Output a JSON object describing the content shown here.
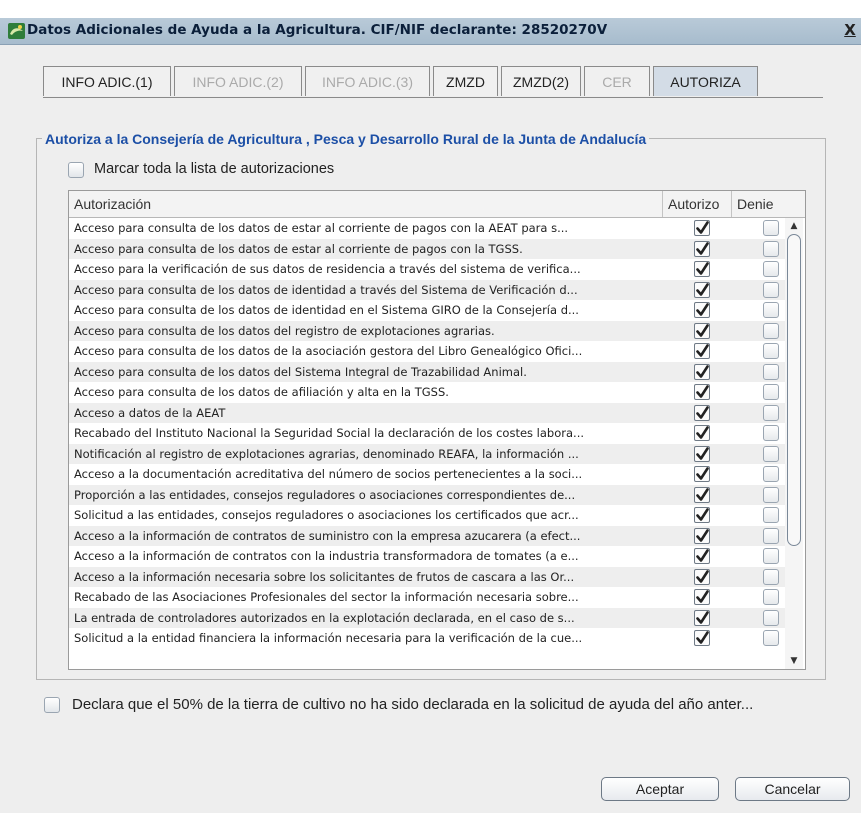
{
  "window": {
    "title": "Datos Adicionales de Ayuda a la Agricultura. CIF/NIF declarante: 28520270V",
    "close_label": "X"
  },
  "tabs": [
    {
      "label": "INFO ADIC.(1)",
      "state": "enabled"
    },
    {
      "label": "INFO ADIC.(2)",
      "state": "disabled"
    },
    {
      "label": "INFO ADIC.(3)",
      "state": "disabled"
    },
    {
      "label": "ZMZD",
      "state": "enabled"
    },
    {
      "label": "ZMZD(2)",
      "state": "enabled"
    },
    {
      "label": "CER",
      "state": "disabled"
    },
    {
      "label": "AUTORIZA",
      "state": "selected"
    }
  ],
  "group": {
    "title": "Autoriza a la Consejería de Agricultura , Pesca y Desarrollo Rural de la Junta de Andalucía",
    "mark_all_label": "Marcar toda la lista de autorizaciones"
  },
  "table": {
    "headers": [
      "Autorización",
      "Autorizo",
      "Denie"
    ],
    "rows": [
      {
        "text": "Acceso para consulta de los datos de estar al corriente de pagos con la AEAT  para s...",
        "autorizo": true,
        "deniego": false
      },
      {
        "text": "Acceso para consulta de los datos de estar al corriente de pagos con la TGSS.",
        "autorizo": true,
        "deniego": false
      },
      {
        "text": "Acceso para la verificación de sus datos de residencia a través del sistema de verifica...",
        "autorizo": true,
        "deniego": false
      },
      {
        "text": "Acceso para consulta de los datos de identidad a través del Sistema de Verificación d...",
        "autorizo": true,
        "deniego": false
      },
      {
        "text": "Acceso para consulta de los datos de identidad en el Sistema GIRO de la Consejería d...",
        "autorizo": true,
        "deniego": false
      },
      {
        "text": "Acceso para consulta de los datos del registro de explotaciones agrarias.",
        "autorizo": true,
        "deniego": false
      },
      {
        "text": "Acceso para consulta de los datos de la asociación gestora del Libro Genealógico Ofici...",
        "autorizo": true,
        "deniego": false
      },
      {
        "text": "Acceso para consulta de los datos del Sistema Integral de Trazabilidad Animal.",
        "autorizo": true,
        "deniego": false
      },
      {
        "text": "Acceso para consulta de los datos de afiliación y alta en la TGSS.",
        "autorizo": true,
        "deniego": false
      },
      {
        "text": "Acceso a datos de la AEAT",
        "autorizo": true,
        "deniego": false
      },
      {
        "text": "Recabado del Instituto Nacional la Seguridad Social la declaración de los costes labora...",
        "autorizo": true,
        "deniego": false
      },
      {
        "text": "Notificación al registro de explotaciones agrarias, denominado REAFA, la información ...",
        "autorizo": true,
        "deniego": false
      },
      {
        "text": "Acceso a la documentación acreditativa del número de socios pertenecientes a la soci...",
        "autorizo": true,
        "deniego": false
      },
      {
        "text": "Proporción a las entidades, consejos reguladores o asociaciones correspondientes de...",
        "autorizo": true,
        "deniego": false
      },
      {
        "text": "Solicitud a las entidades, consejos reguladores o asociaciones los certificados que acr...",
        "autorizo": true,
        "deniego": false
      },
      {
        "text": "Acceso a la información de contratos de suministro con la empresa azucarera (a efect...",
        "autorizo": true,
        "deniego": false
      },
      {
        "text": "Acceso a la información de contratos con la industria transformadora de tomates (a e...",
        "autorizo": true,
        "deniego": false
      },
      {
        "text": "Acceso a la información necesaria sobre los solicitantes de frutos de cascara a las Or...",
        "autorizo": true,
        "deniego": false
      },
      {
        "text": "Recabado de las Asociaciones Profesionales del sector la información necesaria sobre...",
        "autorizo": true,
        "deniego": false
      },
      {
        "text": "La entrada de controladores autorizados en la explotación declarada, en el caso de s...",
        "autorizo": true,
        "deniego": false
      },
      {
        "text": "Solicitud a la entidad financiera la información necesaria para la verificación de la cue...",
        "autorizo": true,
        "deniego": false
      }
    ]
  },
  "declaration_label": "Declara que el 50% de la tierra de cultivo no ha sido declarada en la solicitud de ayuda del año anter...",
  "buttons": {
    "accept": "Aceptar",
    "cancel": "Cancelar"
  },
  "colors": {
    "group_title": "#1c4fa6",
    "titlebar": "#a7bccd",
    "selected_tab": "#d3dce6",
    "dialog_bg": "#eeeeee"
  }
}
